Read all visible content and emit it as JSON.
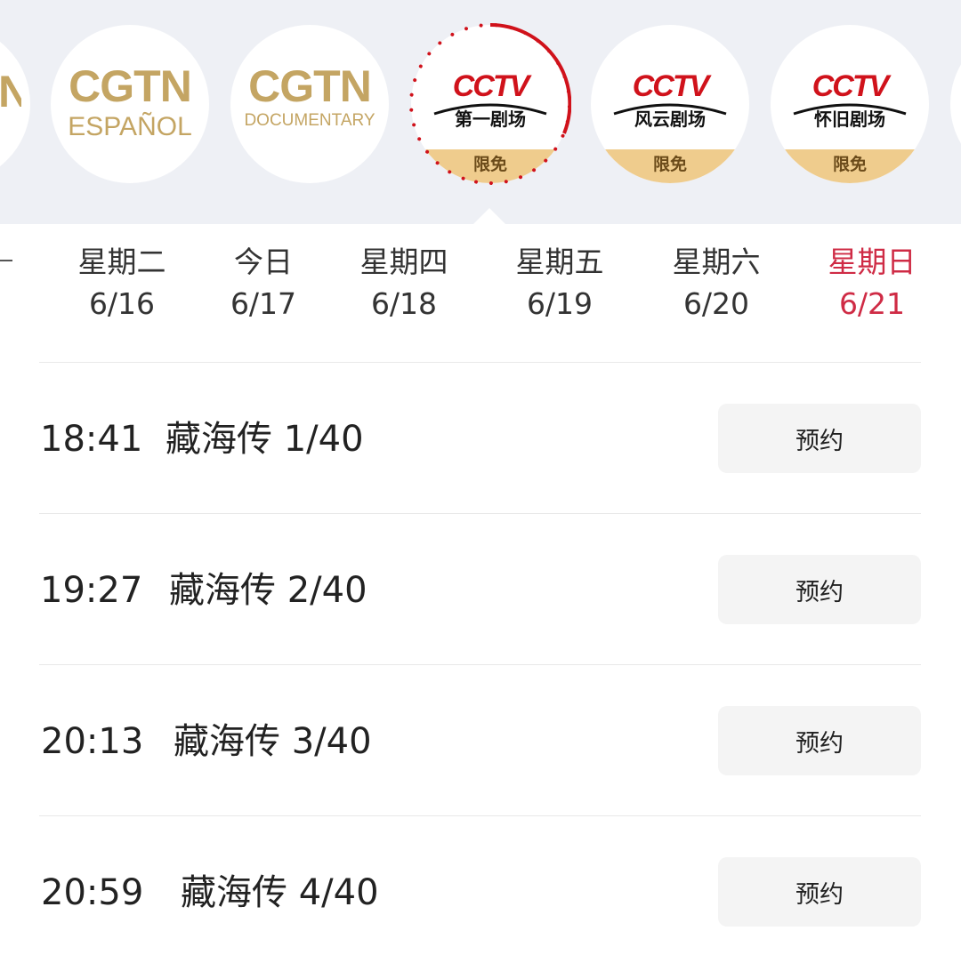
{
  "channels": [
    {
      "type": "partial",
      "text": "N"
    },
    {
      "type": "cgtn",
      "main": "CGTN",
      "sub": "ESPAÑOL"
    },
    {
      "type": "cgtn",
      "main": "CGTN",
      "sub": "DOCUMENTARY"
    },
    {
      "type": "cctv",
      "logo": "CCTV",
      "name": "第一剧场",
      "badge": "限免",
      "selected": true
    },
    {
      "type": "cctv",
      "logo": "CCTV",
      "name": "风云剧场",
      "badge": "限免"
    },
    {
      "type": "cctv",
      "logo": "CCTV",
      "name": "怀旧剧场",
      "badge": "限免"
    }
  ],
  "days": [
    {
      "weekday": "星期二",
      "date": "6/16"
    },
    {
      "weekday": "今日",
      "date": "6/17"
    },
    {
      "weekday": "星期四",
      "date": "6/18"
    },
    {
      "weekday": "星期五",
      "date": "6/19"
    },
    {
      "weekday": "星期六",
      "date": "6/20"
    },
    {
      "weekday": "星期日",
      "date": "6/21",
      "active": true
    }
  ],
  "programs": [
    {
      "time": "18:41",
      "title": "藏海传 1/40",
      "action": "预约"
    },
    {
      "time": "19:27",
      "title": "藏海传 2/40",
      "action": "预约"
    },
    {
      "time": "20:13",
      "title": "藏海传 3/40",
      "action": "预约"
    },
    {
      "time": "20:59",
      "title": "藏海传 4/40",
      "action": "预约"
    }
  ],
  "colors": {
    "strip_bg": "#eef0f5",
    "cgtn_gold": "#c4a563",
    "badge_bg": "#efcc8d",
    "cctv_red": "#d0121b",
    "active_day": "#cf2b45",
    "button_bg": "#f4f4f4"
  }
}
